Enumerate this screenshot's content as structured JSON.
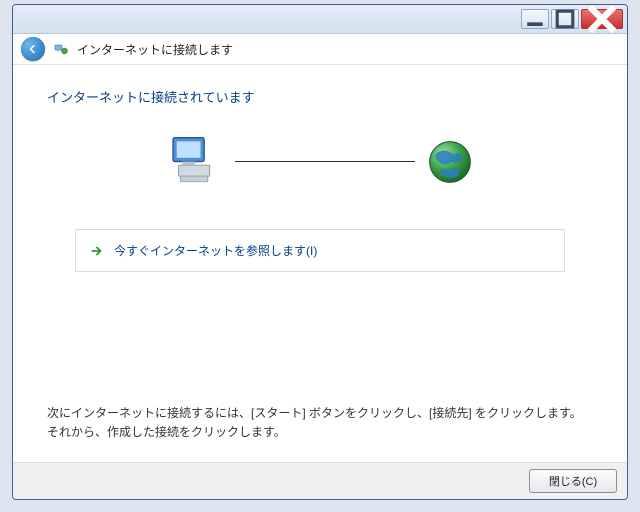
{
  "titlebar": {},
  "nav": {
    "title": "インターネットに接続します"
  },
  "content": {
    "heading": "インターネットに接続されています",
    "option_label": "今すぐインターネットを参照します(I)",
    "hint": "次にインターネットに接続するには、[スタート] ボタンをクリックし、[接続先] をクリックします。それから、作成した接続をクリックします。"
  },
  "footer": {
    "close_label": "閉じる(C)"
  }
}
